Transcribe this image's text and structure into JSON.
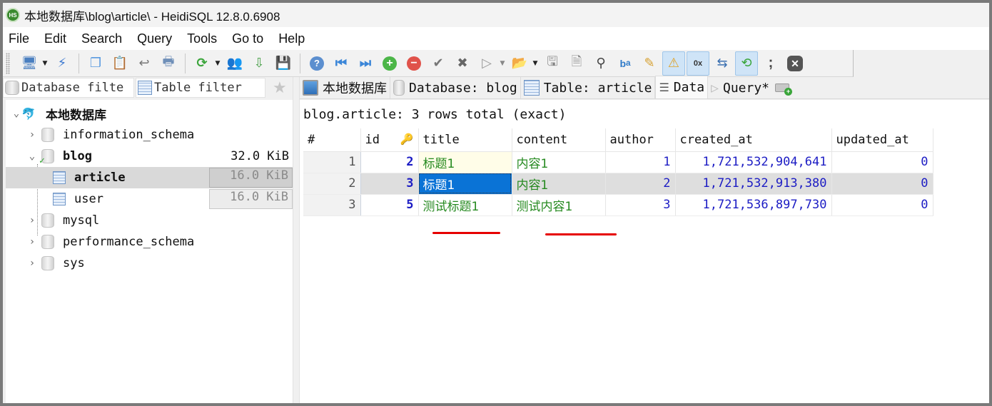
{
  "window": {
    "app_icon": "HS",
    "title": "本地数据库\\blog\\article\\ - HeidiSQL 12.8.0.6908"
  },
  "menu": [
    "File",
    "Edit",
    "Search",
    "Query",
    "Tools",
    "Go to",
    "Help"
  ],
  "toolbar": {
    "icons": [
      "connect-icon",
      "dropdown-arrow",
      "disconnect-icon",
      "separator",
      "copy-icon",
      "paste-icon",
      "undo-icon",
      "print-icon",
      "separator",
      "refresh-icon",
      "dropdown-arrow",
      "user-manager-icon",
      "import-icon",
      "export-database-icon",
      "separator",
      "help-icon",
      "first-record-icon",
      "last-record-icon",
      "insert-row-icon",
      "delete-row-icon",
      "post-icon",
      "cancel-icon",
      "run-icon",
      "dropdown-arrow",
      "open-file-icon",
      "dropdown-arrow",
      "save-icon",
      "save-as-icon",
      "find-icon",
      "replace-icon",
      "edit-icon",
      "warning-icon",
      "hex-icon",
      "wrap-icon",
      "format-sql-icon",
      "semicolon-icon",
      "stop-icon"
    ]
  },
  "filters": {
    "database_filter_placeholder": "Database filte",
    "table_filter_placeholder": "Table filter"
  },
  "tree": {
    "root": "本地数据库",
    "items": [
      {
        "label": "information_schema",
        "size": "",
        "expanded": false
      },
      {
        "label": "blog",
        "size": "32.0 KiB",
        "expanded": true,
        "children": [
          {
            "label": "article",
            "size": "16.0 KiB",
            "selected": true
          },
          {
            "label": "user",
            "size": "16.0 KiB",
            "selected": false
          }
        ]
      },
      {
        "label": "mysql",
        "size": "",
        "expanded": false
      },
      {
        "label": "performance_schema",
        "size": "",
        "expanded": false
      },
      {
        "label": "sys",
        "size": "",
        "expanded": false
      }
    ]
  },
  "tabs": [
    {
      "label": "本地数据库",
      "icon": "host-icon"
    },
    {
      "label": "Database: blog",
      "icon": "database-icon"
    },
    {
      "label": "Table: article",
      "icon": "table-icon"
    },
    {
      "label": "Data",
      "icon": "data-grid-icon",
      "active": true
    },
    {
      "label": "Query*",
      "icon": "query-icon"
    }
  ],
  "data_view": {
    "status": "blog.article: 3 rows total (exact)",
    "columns": [
      "#",
      "id",
      "title",
      "content",
      "author",
      "created_at",
      "updated_at"
    ],
    "rows": [
      {
        "n": "1",
        "id": "2",
        "title": "标题1",
        "content": "内容1",
        "author": "1",
        "created_at": "1,721,532,904,641",
        "updated_at": "0"
      },
      {
        "n": "2",
        "id": "3",
        "title": "标题1",
        "content": "内容1",
        "author": "2",
        "created_at": "1,721,532,913,380",
        "updated_at": "0"
      },
      {
        "n": "3",
        "id": "5",
        "title": "测试标题1",
        "content": "测试内容1",
        "author": "3",
        "created_at": "1,721,536,897,730",
        "updated_at": "0"
      }
    ],
    "selected_cell": {
      "row": 2,
      "column": "title"
    },
    "annotation_color": "#e60000"
  }
}
